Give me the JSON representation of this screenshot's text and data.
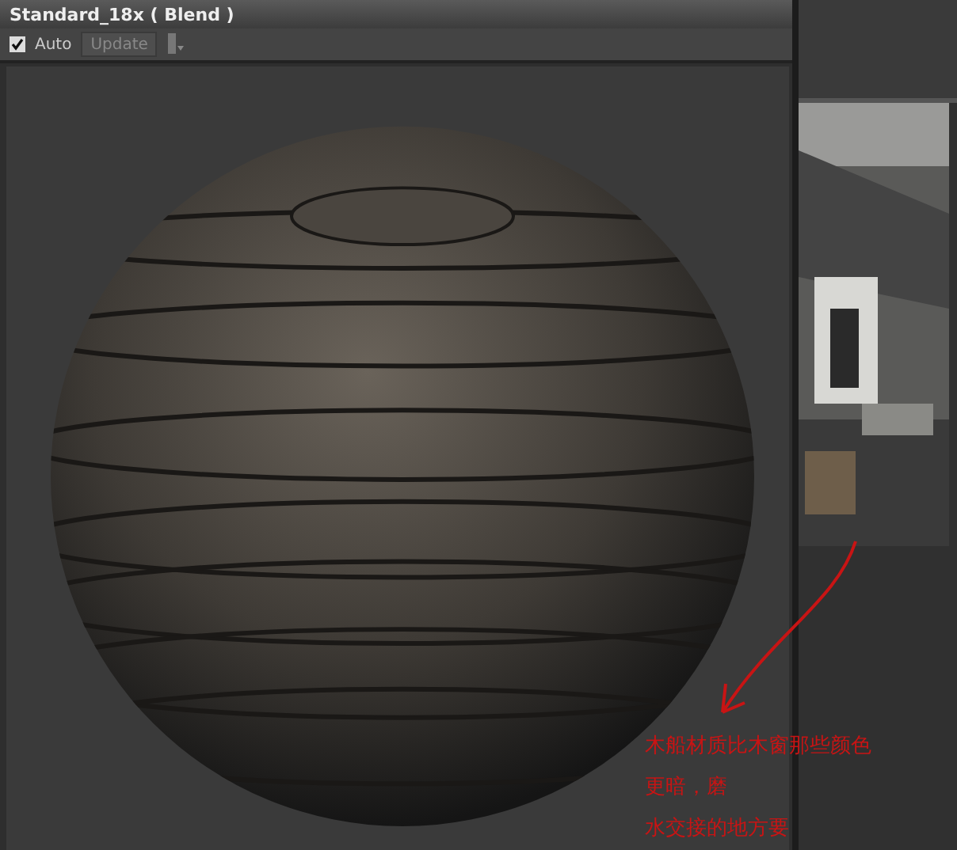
{
  "window": {
    "title": "Standard_18x  ( Blend )"
  },
  "toolbar": {
    "auto": {
      "label": "Auto",
      "checked": true
    },
    "update_button": {
      "label": "Update",
      "disabled": true
    }
  },
  "annotation": {
    "lines": [
      "木船材质比木窗那些颜色",
      "更暗，磨",
      "水交接的地方要"
    ]
  }
}
